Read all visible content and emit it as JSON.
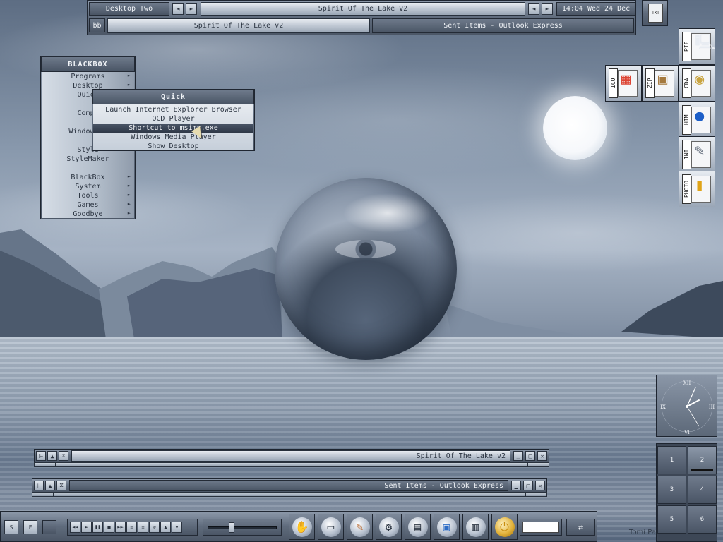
{
  "toolbar": {
    "workspace": "Desktop Two",
    "window_title": "Spirit Of The Lake v2",
    "clock": "14:04 Wed 24 Dec",
    "bb_button": "bb",
    "tasks": [
      "Spirit Of The Lake v2",
      "Sent Items - Outlook Express"
    ],
    "prev_arrow": "◄",
    "next_arrow": "►"
  },
  "menu": {
    "title": "BLACKBOX",
    "items": [
      {
        "label": "Programs",
        "submenu": true
      },
      {
        "label": "Desktop",
        "submenu": true
      },
      {
        "label": "Quick",
        "submenu": true
      },
      {
        "label": "",
        "submenu": false
      },
      {
        "label": "Compu",
        "submenu": false
      },
      {
        "label": "",
        "submenu": false
      },
      {
        "label": "Windows E",
        "submenu": false
      },
      {
        "label": "",
        "submenu": false
      },
      {
        "label": "Style",
        "submenu": false
      },
      {
        "label": "StyleMaker",
        "submenu": false
      },
      {
        "label": "",
        "submenu": false
      },
      {
        "label": "BlackBox",
        "submenu": true
      },
      {
        "label": "System",
        "submenu": true
      },
      {
        "label": "Tools",
        "submenu": true
      },
      {
        "label": "Games",
        "submenu": true
      },
      {
        "label": "Goodbye",
        "submenu": true
      }
    ],
    "submenu_arrow": "►"
  },
  "quick_menu": {
    "title": "Quick",
    "items": [
      "Launch Internet Explorer Browser",
      "QCD Player",
      "Shortcut to msimn.exe",
      "Windows Media Player",
      "Show Desktop"
    ],
    "active_index": 2
  },
  "file_icons": {
    "txt": {
      "tag": "TXT",
      "icon": "text-file-icon"
    },
    "pif": {
      "tag": "PIF",
      "icon": "pif-file-icon"
    },
    "ico": {
      "tag": "ICO",
      "icon": "ico-file-icon"
    },
    "zip": {
      "tag": "ZIP",
      "icon": "zip-file-icon"
    },
    "cda": {
      "tag": "CDA",
      "icon": "cda-file-icon"
    },
    "htm": {
      "tag": "HTM",
      "icon": "htm-file-icon"
    },
    "ini": {
      "tag": "INI",
      "icon": "ini-file-icon"
    },
    "photo": {
      "tag": "PHOTO",
      "icon": "photo-file-icon"
    }
  },
  "clock": {
    "numerals": [
      "XII",
      "III",
      "VI",
      "IX"
    ],
    "hour": 2,
    "minute": 4
  },
  "pager": {
    "desktops": [
      "1",
      "2",
      "3",
      "4",
      "5",
      "6"
    ],
    "current": "2"
  },
  "windows": [
    {
      "title": "Spirit Of The Lake v2"
    },
    {
      "title": "Sent Items - Outlook Express"
    }
  ],
  "window_buttons": {
    "shade": "▲",
    "minimize": "▁",
    "maximize": "□",
    "close": "✕",
    "stick": "⧖",
    "pin": "⊩"
  },
  "slit": {
    "btn1": "S",
    "btn2": "F",
    "media_buttons": [
      "◄◄",
      "►",
      "❚❚",
      "■",
      "►►",
      "≡",
      "≡",
      "⊙",
      "▲",
      "▼"
    ],
    "volume": 0.33,
    "dock": [
      {
        "name": "hand-icon",
        "glyph": "✋"
      },
      {
        "name": "drive-icon",
        "glyph": "▭"
      },
      {
        "name": "tools-icon",
        "glyph": "✎"
      },
      {
        "name": "film-reel-icon",
        "glyph": "⚙"
      },
      {
        "name": "folder-icon",
        "glyph": "▤"
      },
      {
        "name": "monitor-icon",
        "glyph": "▣"
      },
      {
        "name": "briefcase-icon",
        "glyph": "▥"
      },
      {
        "name": "power-icon",
        "glyph": "⏻"
      }
    ],
    "net_glyph": "⇄"
  },
  "credit": "Tomi Pay"
}
